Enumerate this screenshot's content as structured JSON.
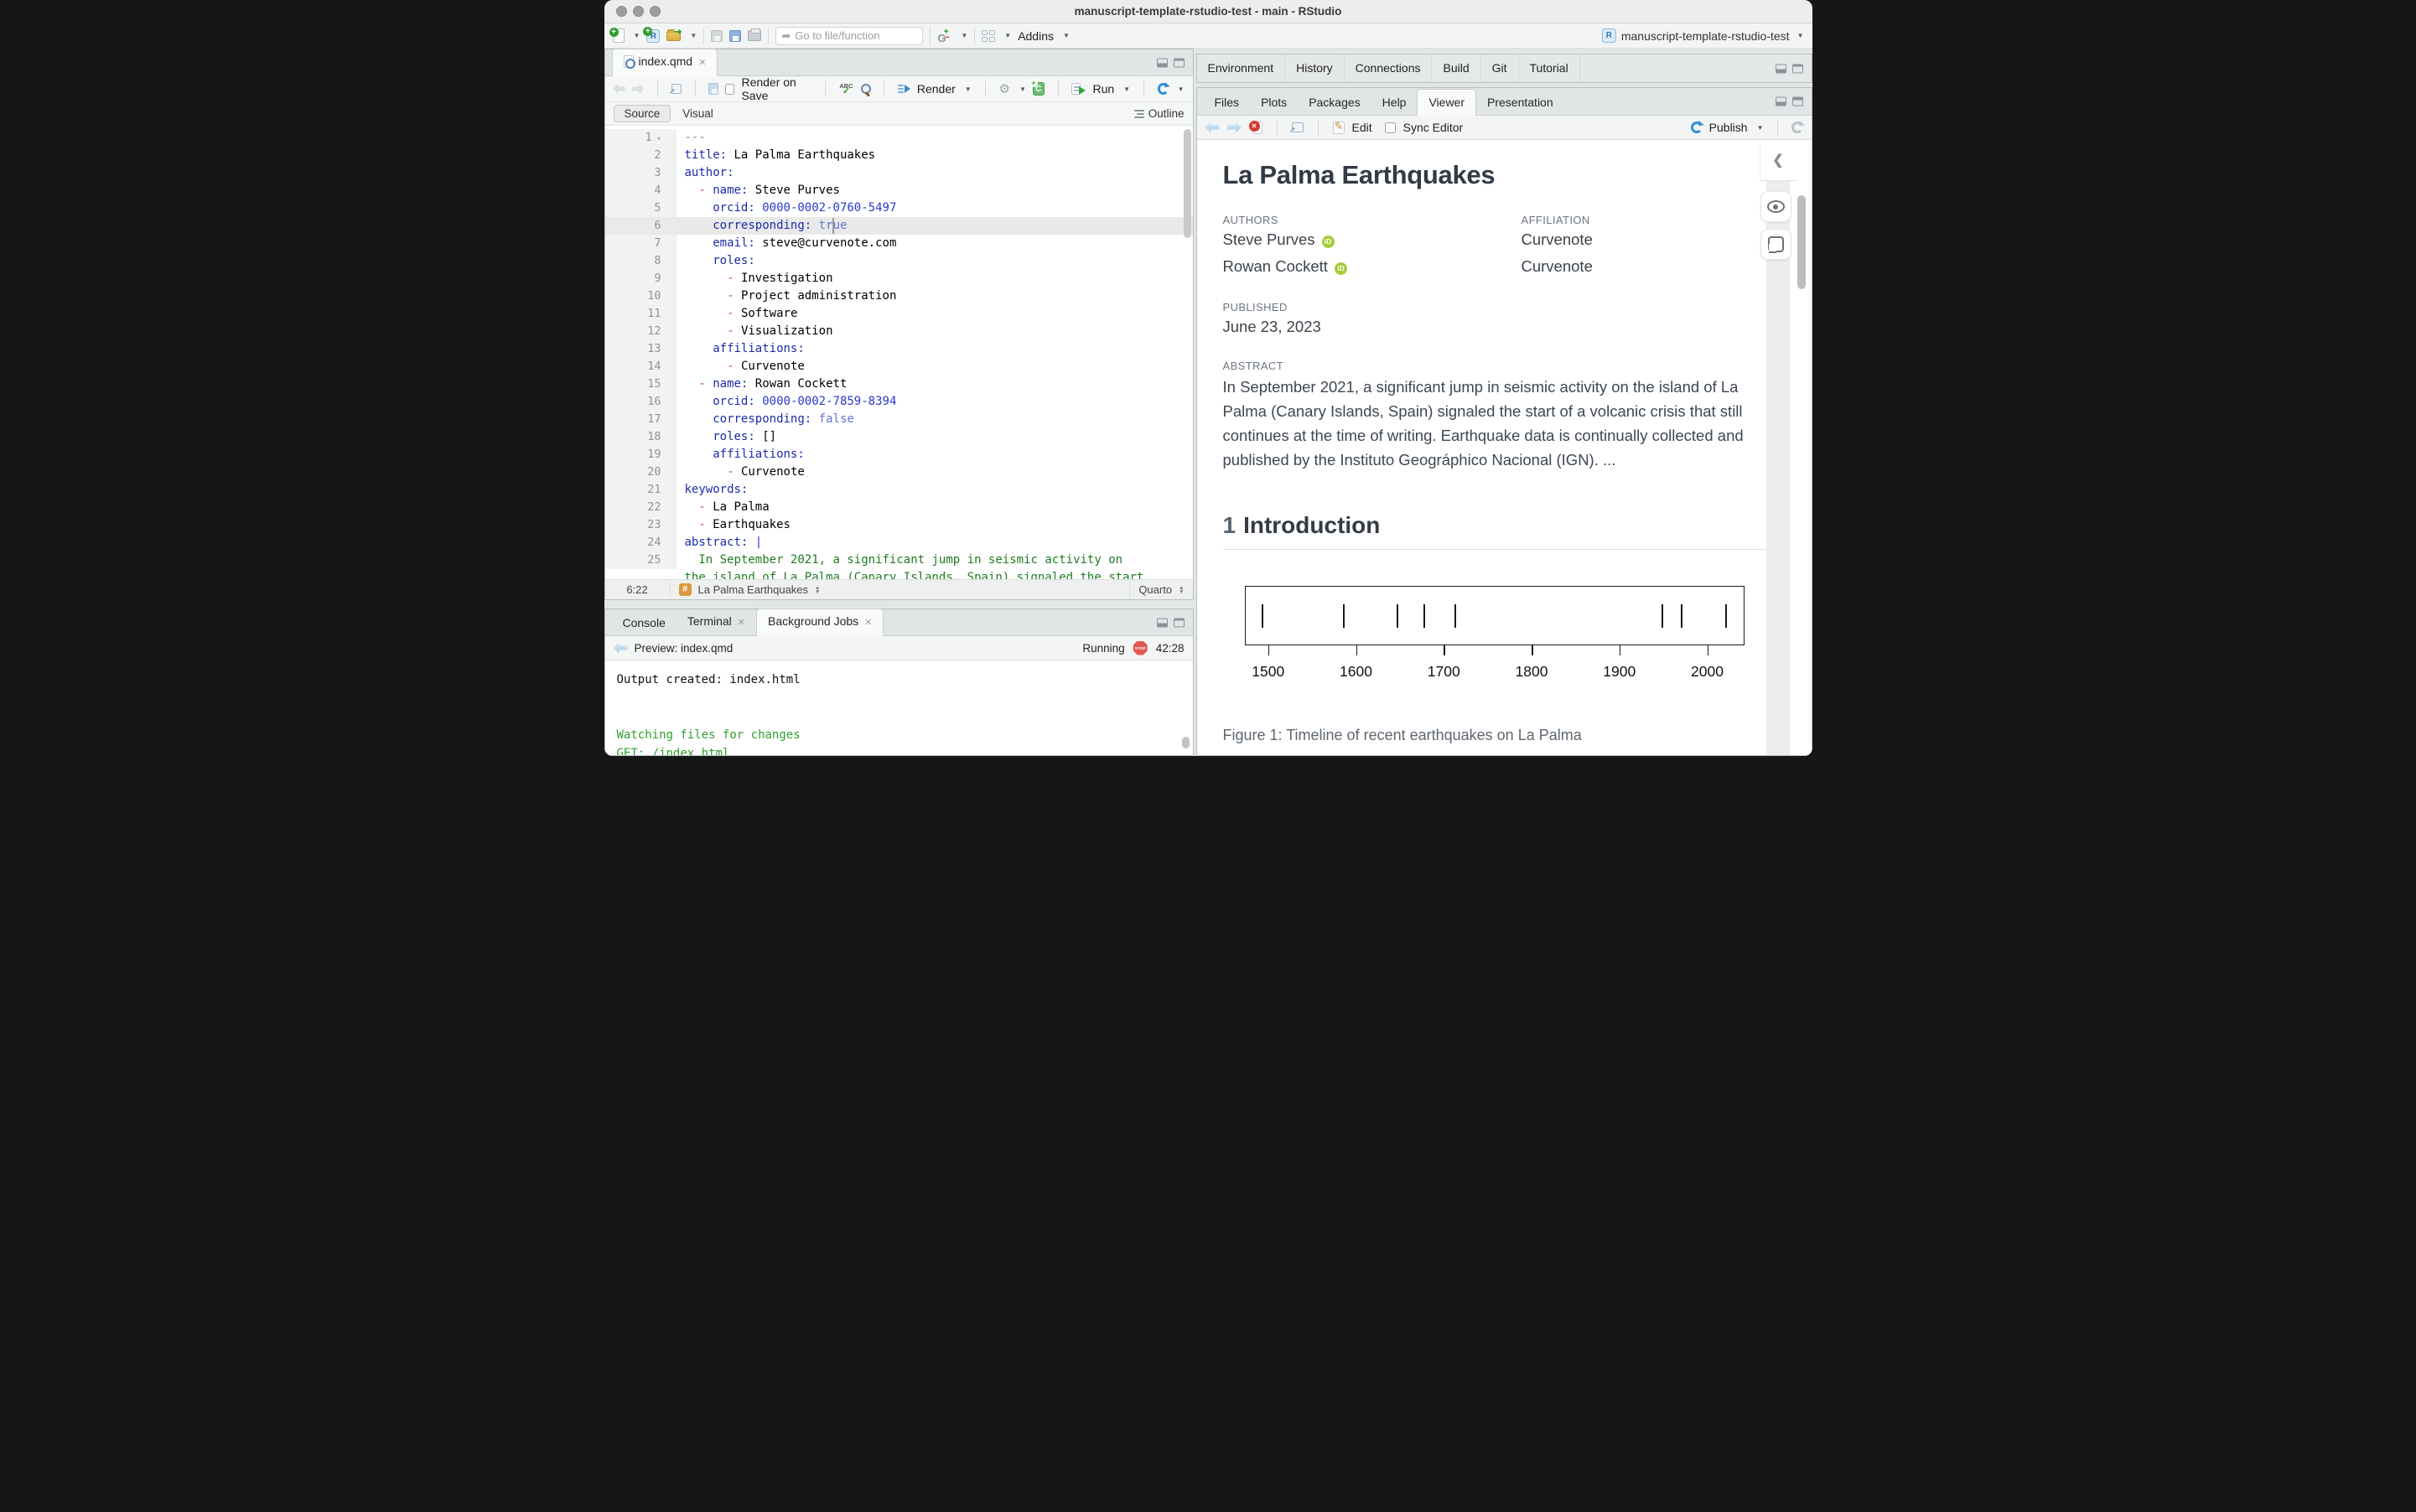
{
  "window": {
    "title": "manuscript-template-rstudio-test - main - RStudio",
    "project": "manuscript-template-rstudio-test"
  },
  "toolbar": {
    "goto_placeholder": "Go to file/function",
    "addins": "Addins"
  },
  "editor": {
    "tab": "index.qmd",
    "render_on_save": "Render on Save",
    "spell_abc": "ABC",
    "render": "Render",
    "run": "Run",
    "source": "Source",
    "visual": "Visual",
    "outline": "Outline",
    "status_position": "6:22",
    "status_section": "La Palma Earthquakes",
    "status_mode": "Quarto"
  },
  "code": {
    "lines": [
      {
        "n": "1",
        "fold": true,
        "toks": [
          [
            "d",
            "---"
          ]
        ]
      },
      {
        "n": "2",
        "toks": [
          [
            "k",
            "title:"
          ],
          [
            "p",
            " La Palma Earthquakes"
          ]
        ]
      },
      {
        "n": "3",
        "toks": [
          [
            "k",
            "author:"
          ]
        ]
      },
      {
        "n": "4",
        "toks": [
          [
            "p",
            "  "
          ],
          [
            "h",
            "- "
          ],
          [
            "k",
            "name:"
          ],
          [
            "p",
            " Steve Purves"
          ]
        ]
      },
      {
        "n": "5",
        "toks": [
          [
            "p",
            "    "
          ],
          [
            "k",
            "orcid:"
          ],
          [
            "n",
            " 0000-0002-0760-5497"
          ]
        ]
      },
      {
        "n": "6",
        "current": true,
        "toks": [
          [
            "p",
            "    "
          ],
          [
            "k",
            "corresponding:"
          ],
          [
            "b",
            " true"
          ]
        ]
      },
      {
        "n": "7",
        "toks": [
          [
            "p",
            "    "
          ],
          [
            "k",
            "email:"
          ],
          [
            "p",
            " steve@curvenote.com"
          ]
        ]
      },
      {
        "n": "8",
        "toks": [
          [
            "p",
            "    "
          ],
          [
            "k",
            "roles:"
          ]
        ]
      },
      {
        "n": "9",
        "toks": [
          [
            "p",
            "      "
          ],
          [
            "h",
            "- "
          ],
          [
            "p",
            "Investigation"
          ]
        ]
      },
      {
        "n": "10",
        "toks": [
          [
            "p",
            "      "
          ],
          [
            "h",
            "- "
          ],
          [
            "p",
            "Project administration"
          ]
        ]
      },
      {
        "n": "11",
        "toks": [
          [
            "p",
            "      "
          ],
          [
            "h",
            "- "
          ],
          [
            "p",
            "Software"
          ]
        ]
      },
      {
        "n": "12",
        "toks": [
          [
            "p",
            "      "
          ],
          [
            "h",
            "- "
          ],
          [
            "p",
            "Visualization"
          ]
        ]
      },
      {
        "n": "13",
        "toks": [
          [
            "p",
            "    "
          ],
          [
            "k",
            "affiliations:"
          ]
        ]
      },
      {
        "n": "14",
        "toks": [
          [
            "p",
            "      "
          ],
          [
            "h",
            "- "
          ],
          [
            "p",
            "Curvenote"
          ]
        ]
      },
      {
        "n": "15",
        "toks": [
          [
            "p",
            "  "
          ],
          [
            "h",
            "- "
          ],
          [
            "k",
            "name:"
          ],
          [
            "p",
            " Rowan Cockett"
          ]
        ]
      },
      {
        "n": "16",
        "toks": [
          [
            "p",
            "    "
          ],
          [
            "k",
            "orcid:"
          ],
          [
            "n",
            " 0000-0002-7859-8394"
          ]
        ]
      },
      {
        "n": "17",
        "toks": [
          [
            "p",
            "    "
          ],
          [
            "k",
            "corresponding:"
          ],
          [
            "b",
            " false"
          ]
        ]
      },
      {
        "n": "18",
        "toks": [
          [
            "p",
            "    "
          ],
          [
            "k",
            "roles:"
          ],
          [
            "p",
            " []"
          ]
        ]
      },
      {
        "n": "19",
        "toks": [
          [
            "p",
            "    "
          ],
          [
            "k",
            "affiliations:"
          ]
        ]
      },
      {
        "n": "20",
        "toks": [
          [
            "p",
            "      "
          ],
          [
            "h",
            "- "
          ],
          [
            "p",
            "Curvenote"
          ]
        ]
      },
      {
        "n": "21",
        "toks": [
          [
            "k",
            "keywords:"
          ]
        ]
      },
      {
        "n": "22",
        "toks": [
          [
            "p",
            "  "
          ],
          [
            "h",
            "- "
          ],
          [
            "p",
            "La Palma"
          ]
        ]
      },
      {
        "n": "23",
        "toks": [
          [
            "p",
            "  "
          ],
          [
            "h",
            "- "
          ],
          [
            "p",
            "Earthquakes"
          ]
        ]
      },
      {
        "n": "24",
        "toks": [
          [
            "k",
            "abstract:"
          ],
          [
            "n",
            " |"
          ]
        ]
      },
      {
        "n": "25",
        "toks": [
          [
            "s",
            "  In September 2021, a significant jump in seismic activity on"
          ]
        ]
      },
      {
        "n": "",
        "toks": [
          [
            "s",
            "the island of La Palma (Canary Islands, Spain) signaled the start"
          ]
        ]
      }
    ]
  },
  "console": {
    "tabs": [
      {
        "label": "Console",
        "closable": false,
        "active": false
      },
      {
        "label": "Terminal",
        "closable": true,
        "active": false
      },
      {
        "label": "Background Jobs",
        "closable": true,
        "active": true
      }
    ],
    "preview": "Preview: index.qmd",
    "running": "Running",
    "elapsed": "42:28",
    "stop_label": "STOP",
    "lines": [
      {
        "t": "Output created: index.html",
        "c": "plain"
      },
      {
        "t": "",
        "c": "plain"
      },
      {
        "t": "",
        "c": "plain"
      },
      {
        "t": "Watching files for changes",
        "c": "green"
      },
      {
        "t": "GET: /index.html",
        "c": "green"
      }
    ]
  },
  "env_tabs": [
    "Environment",
    "History",
    "Connections",
    "Build",
    "Git",
    "Tutorial"
  ],
  "viewer": {
    "tabs": [
      "Files",
      "Plots",
      "Packages",
      "Help",
      "Viewer",
      "Presentation"
    ],
    "active_tab": "Viewer",
    "edit": "Edit",
    "sync": "Sync Editor",
    "publish": "Publish"
  },
  "document": {
    "title": "La Palma Earthquakes",
    "authors_label": "AUTHORS",
    "affiliation_label": "AFFILIATION",
    "authors": [
      {
        "name": "Steve Purves",
        "affiliation": "Curvenote"
      },
      {
        "name": "Rowan Cockett",
        "affiliation": "Curvenote"
      }
    ],
    "published_label": "PUBLISHED",
    "published": "June 23, 2023",
    "abstract_label": "ABSTRACT",
    "abstract": "In September 2021, a significant jump in seismic activity on the island of La Palma (Canary Islands, Spain) signaled the start of a volcanic crisis that still continues at the time of writing. Earthquake data is continually collected and published by the Instituto Geográphico Nacional (IGN). ...",
    "section_number": "1",
    "section_title": "Introduction",
    "figure_caption": "Figure 1: Timeline of recent earthquakes on La Palma"
  },
  "chart_data": {
    "type": "scatter",
    "subtype": "rug-timeline",
    "title": "Timeline of recent earthquakes on La Palma",
    "values": [
      1492,
      1585,
      1646,
      1677,
      1712,
      1949,
      1971,
      2021
    ],
    "x_ticks": [
      1500,
      1600,
      1700,
      1800,
      1900,
      2000
    ],
    "xlim": [
      1473,
      2042
    ],
    "xlabel": "",
    "ylabel": "",
    "grid": false,
    "legend": "none"
  }
}
